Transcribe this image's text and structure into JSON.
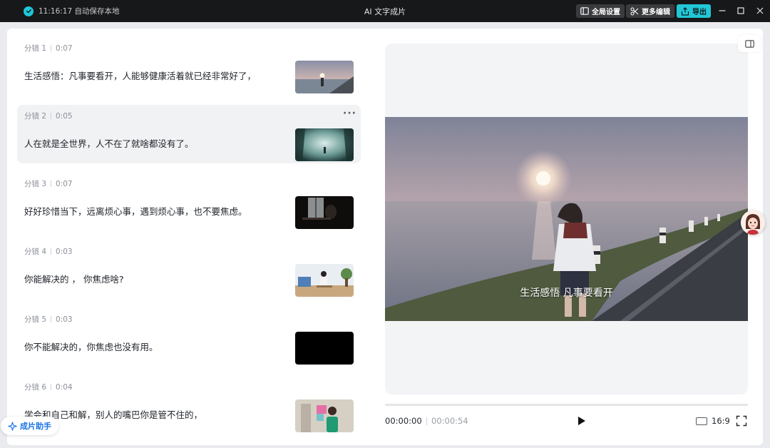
{
  "titlebar": {
    "save_status": "11:16:17 自动保存本地",
    "title": "AI 文字成片",
    "global_settings": "全局设置",
    "more_edit": "更多编辑",
    "export": "导出"
  },
  "shots": [
    {
      "label": "分镜 1",
      "duration": "0:07",
      "text": "生活感悟：凡事要看开，人能够健康活着就已经非常好了，"
    },
    {
      "label": "分镜 2",
      "duration": "0:05",
      "text": "人在就是全世界，人不在了就啥都没有了。"
    },
    {
      "label": "分镜 3",
      "duration": "0:07",
      "text": "好好珍惜当下，远离烦心事，遇到烦心事，也不要焦虑。"
    },
    {
      "label": "分镜 4",
      "duration": "0:03",
      "text": "你能解决的 ， 你焦虑啥?"
    },
    {
      "label": "分镜 5",
      "duration": "0:03",
      "text": "你不能解决的，你焦虑也没有用。"
    },
    {
      "label": "分镜 6",
      "duration": "0:04",
      "text": "学会和自己和解，别人的嘴巴你是管不住的，"
    }
  ],
  "assistant": {
    "label": "成片助手"
  },
  "preview": {
    "subtitle": "生活感悟 凡事要看开"
  },
  "player": {
    "current_time": "00:00:00",
    "total_time": "00:00:54",
    "aspect_ratio": "16:9"
  },
  "colors": {
    "accent": "#22c7d6",
    "titlebar_bg": "#17181a"
  }
}
